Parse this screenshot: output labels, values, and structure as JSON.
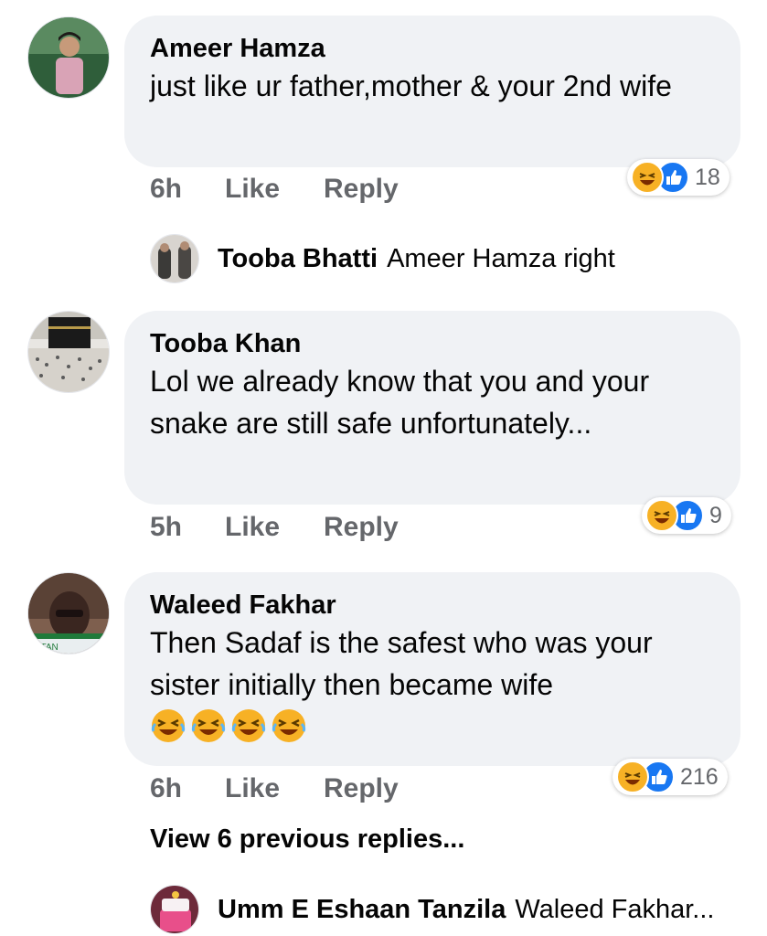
{
  "comments": [
    {
      "author": "Ameer Hamza",
      "text": "just like ur father,mother & your 2nd wife",
      "time": "6h",
      "like_label": "Like",
      "reply_label": "Reply",
      "reaction_count": "18",
      "reactions": [
        "haha-icon",
        "like-icon"
      ]
    },
    {
      "author": "Tooba Khan",
      "text": "Lol we already know that you and your snake are still safe unfortunately...",
      "time": "5h",
      "like_label": "Like",
      "reply_label": "Reply",
      "reaction_count": "9",
      "reactions": [
        "haha-icon",
        "like-icon"
      ]
    },
    {
      "author": "Waleed Fakhar",
      "text": "Then Sadaf is the safest who was your sister initially then became wife",
      "emoji_count": 4,
      "time": "6h",
      "like_label": "Like",
      "reply_label": "Reply",
      "reaction_count": "216",
      "reactions": [
        "haha-icon",
        "like-icon"
      ]
    }
  ],
  "replies": [
    {
      "author": "Tooba Bhatti",
      "text": "Ameer Hamza right"
    },
    {
      "author": "Umm E Eshaan Tanzila",
      "text": "Waleed Fakhar..."
    }
  ],
  "avatar_badge_text": "ISTAN",
  "view_previous_replies": "View 6 previous replies...",
  "colors": {
    "bubble": "#f0f2f5",
    "meta": "#65676b",
    "like_blue": "#1877f2",
    "haha_yellow": "#f7b125"
  }
}
